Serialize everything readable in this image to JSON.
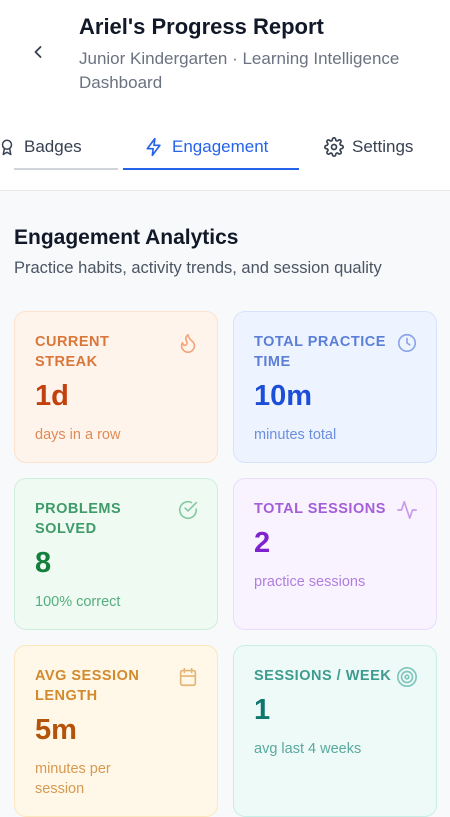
{
  "header": {
    "title": "Ariel's Progress Report",
    "subtitle": "Junior Kindergarten · Learning Intelligence Dashboard"
  },
  "tabs": [
    {
      "label": "Badges",
      "icon": "badge-icon",
      "active": false
    },
    {
      "label": "Engagement",
      "icon": "lightning-icon",
      "active": true
    },
    {
      "label": "Settings",
      "icon": "gear-icon",
      "active": false
    }
  ],
  "section": {
    "title": "Engagement Analytics",
    "description": "Practice habits, activity trends, and session quality"
  },
  "cards": [
    {
      "label": "CURRENT STREAK",
      "value": "1d",
      "sub": "days in a row",
      "icon": "flame-icon",
      "accent": "#c2410c"
    },
    {
      "label": "TOTAL PRACTICE TIME",
      "value": "10m",
      "sub": "minutes total",
      "icon": "clock-icon",
      "accent": "#1d4ed8"
    },
    {
      "label": "PROBLEMS SOLVED",
      "value": "8",
      "sub": "100% correct",
      "icon": "check-circle-icon",
      "accent": "#15803d"
    },
    {
      "label": "TOTAL SESSIONS",
      "value": "2",
      "sub": "practice sessions",
      "icon": "activity-icon",
      "accent": "#7e22ce"
    },
    {
      "label": "AVG SESSION LENGTH",
      "value": "5m",
      "sub": "minutes per session",
      "icon": "calendar-icon",
      "accent": "#b45309"
    },
    {
      "label": "SESSIONS / WEEK",
      "value": "1",
      "sub": "avg last 4 weeks",
      "icon": "target-icon",
      "accent": "#0f766e"
    }
  ]
}
